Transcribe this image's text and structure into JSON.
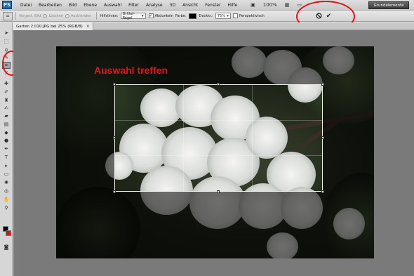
{
  "app": {
    "logo": "PS"
  },
  "menu": [
    "Datei",
    "Bearbeiten",
    "Bild",
    "Ebene",
    "Auswahl",
    "Filter",
    "Analyse",
    "3D",
    "Ansicht",
    "Fenster",
    "Hilfe"
  ],
  "menu_controls": [
    "▣",
    "100%",
    "▦",
    "▭"
  ],
  "workspace_button": "Grundelemente",
  "options": {
    "front_image": "Vorgest. Bild",
    "delete": "Löschen",
    "hide": "Ausblenden",
    "guides_label": "Hilfslinien:",
    "guides_value": "Drittel-Regel",
    "shield_label": "Abdunkeln",
    "color_label": "Farbe:",
    "opacity_label": "Deckkr.:",
    "opacity_value": "75%",
    "perspective_label": "Perspektivisch"
  },
  "document": {
    "tab_title": "Garten 2 010.JPG bei 25% (RGB/8)",
    "close": "×"
  },
  "annotation": {
    "text": "Auswahl treffen"
  },
  "colors": {
    "annotation_red": "#e5101a",
    "foreground": "#000000",
    "background": "#e0101a"
  },
  "icons": {
    "cancel": "cancel-icon",
    "commit": "checkmark-icon",
    "crop_tool": "crop-icon"
  }
}
